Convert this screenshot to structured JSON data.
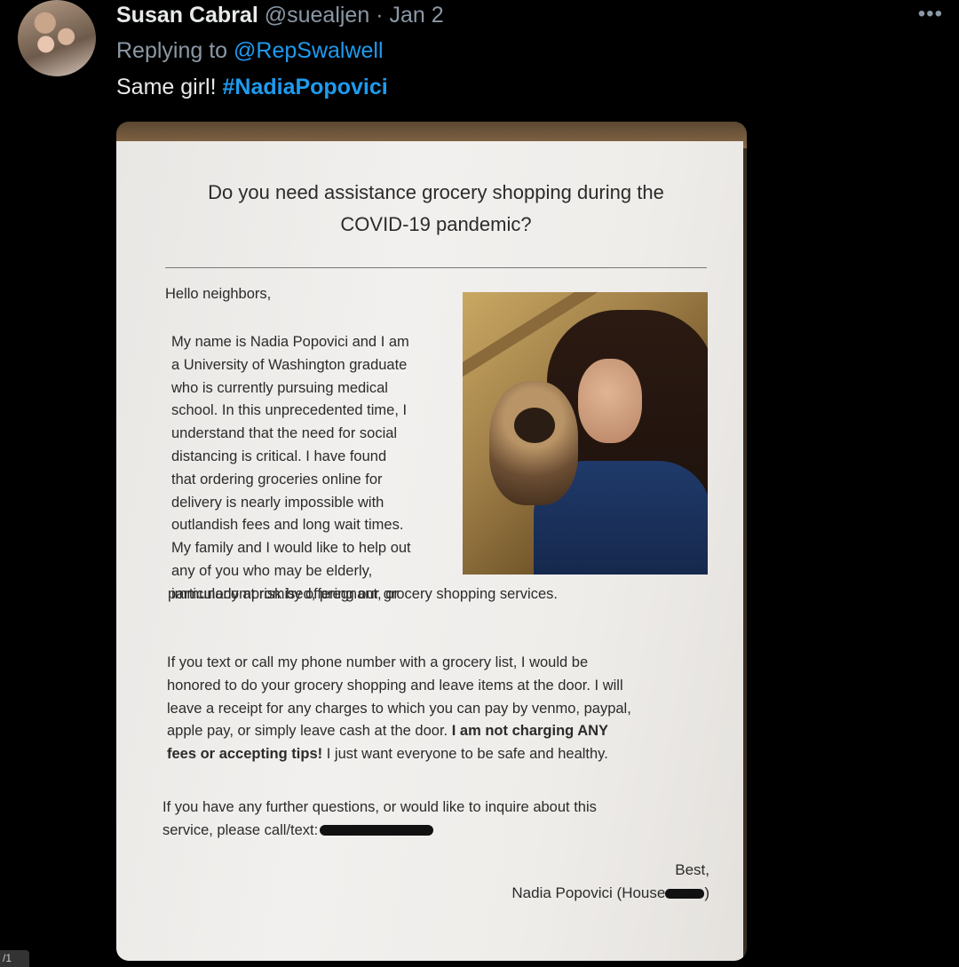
{
  "tweet": {
    "author_name": "Susan Cabral",
    "handle": "@suealjen",
    "separator": "·",
    "date": "Jan 2",
    "more_icon": "more-horizontal-icon",
    "more_label": "•••",
    "reply_prefix": "Replying to",
    "reply_mention": "@RepSwalwell",
    "text": "Same girl!",
    "hashtag": "#NadiaPopovici"
  },
  "flyer": {
    "title_line1": "Do you need assistance grocery shopping during the",
    "title_line2": "COVID-19 pandemic?",
    "greeting": "Hello neighbors,",
    "intro_lines": [
      "My name is Nadia Popovici and I am",
      "a University of Washington graduate",
      "who is currently pursuing medical",
      "school.  In this unprecedented time, I",
      "understand that the need for social",
      "distancing is critical.  I have found",
      "that ordering groceries online for",
      "delivery is nearly impossible with",
      "outlandish fees and long wait times.",
      "My family and I would like to help out",
      "any of you who may be elderly,",
      "immunocompromised, pregnant, or"
    ],
    "intro_last_line": "particularly at risk by offering our grocery shopping services.",
    "para2_lines": [
      "If you text or call my phone number with a grocery list, I would be",
      "honored to do your grocery shopping and leave items at the door.  I will",
      "leave a receipt for any charges to which you can pay by venmo, paypal,"
    ],
    "para2_line4": "apple pay, or simply leave cash at the door.",
    "para2_bold_a": "I am not charging ANY",
    "para2_bold_b": "fees or accepting tips!",
    "para2_end": "I just want everyone to be safe and healthy.",
    "para3_line1": "If you have any further questions, or would like to inquire about this",
    "para3_line2": "service, please call/text:",
    "signoff": "Best,",
    "signature": "Nadia Popovici (House"
  },
  "media_counter": "/1"
}
